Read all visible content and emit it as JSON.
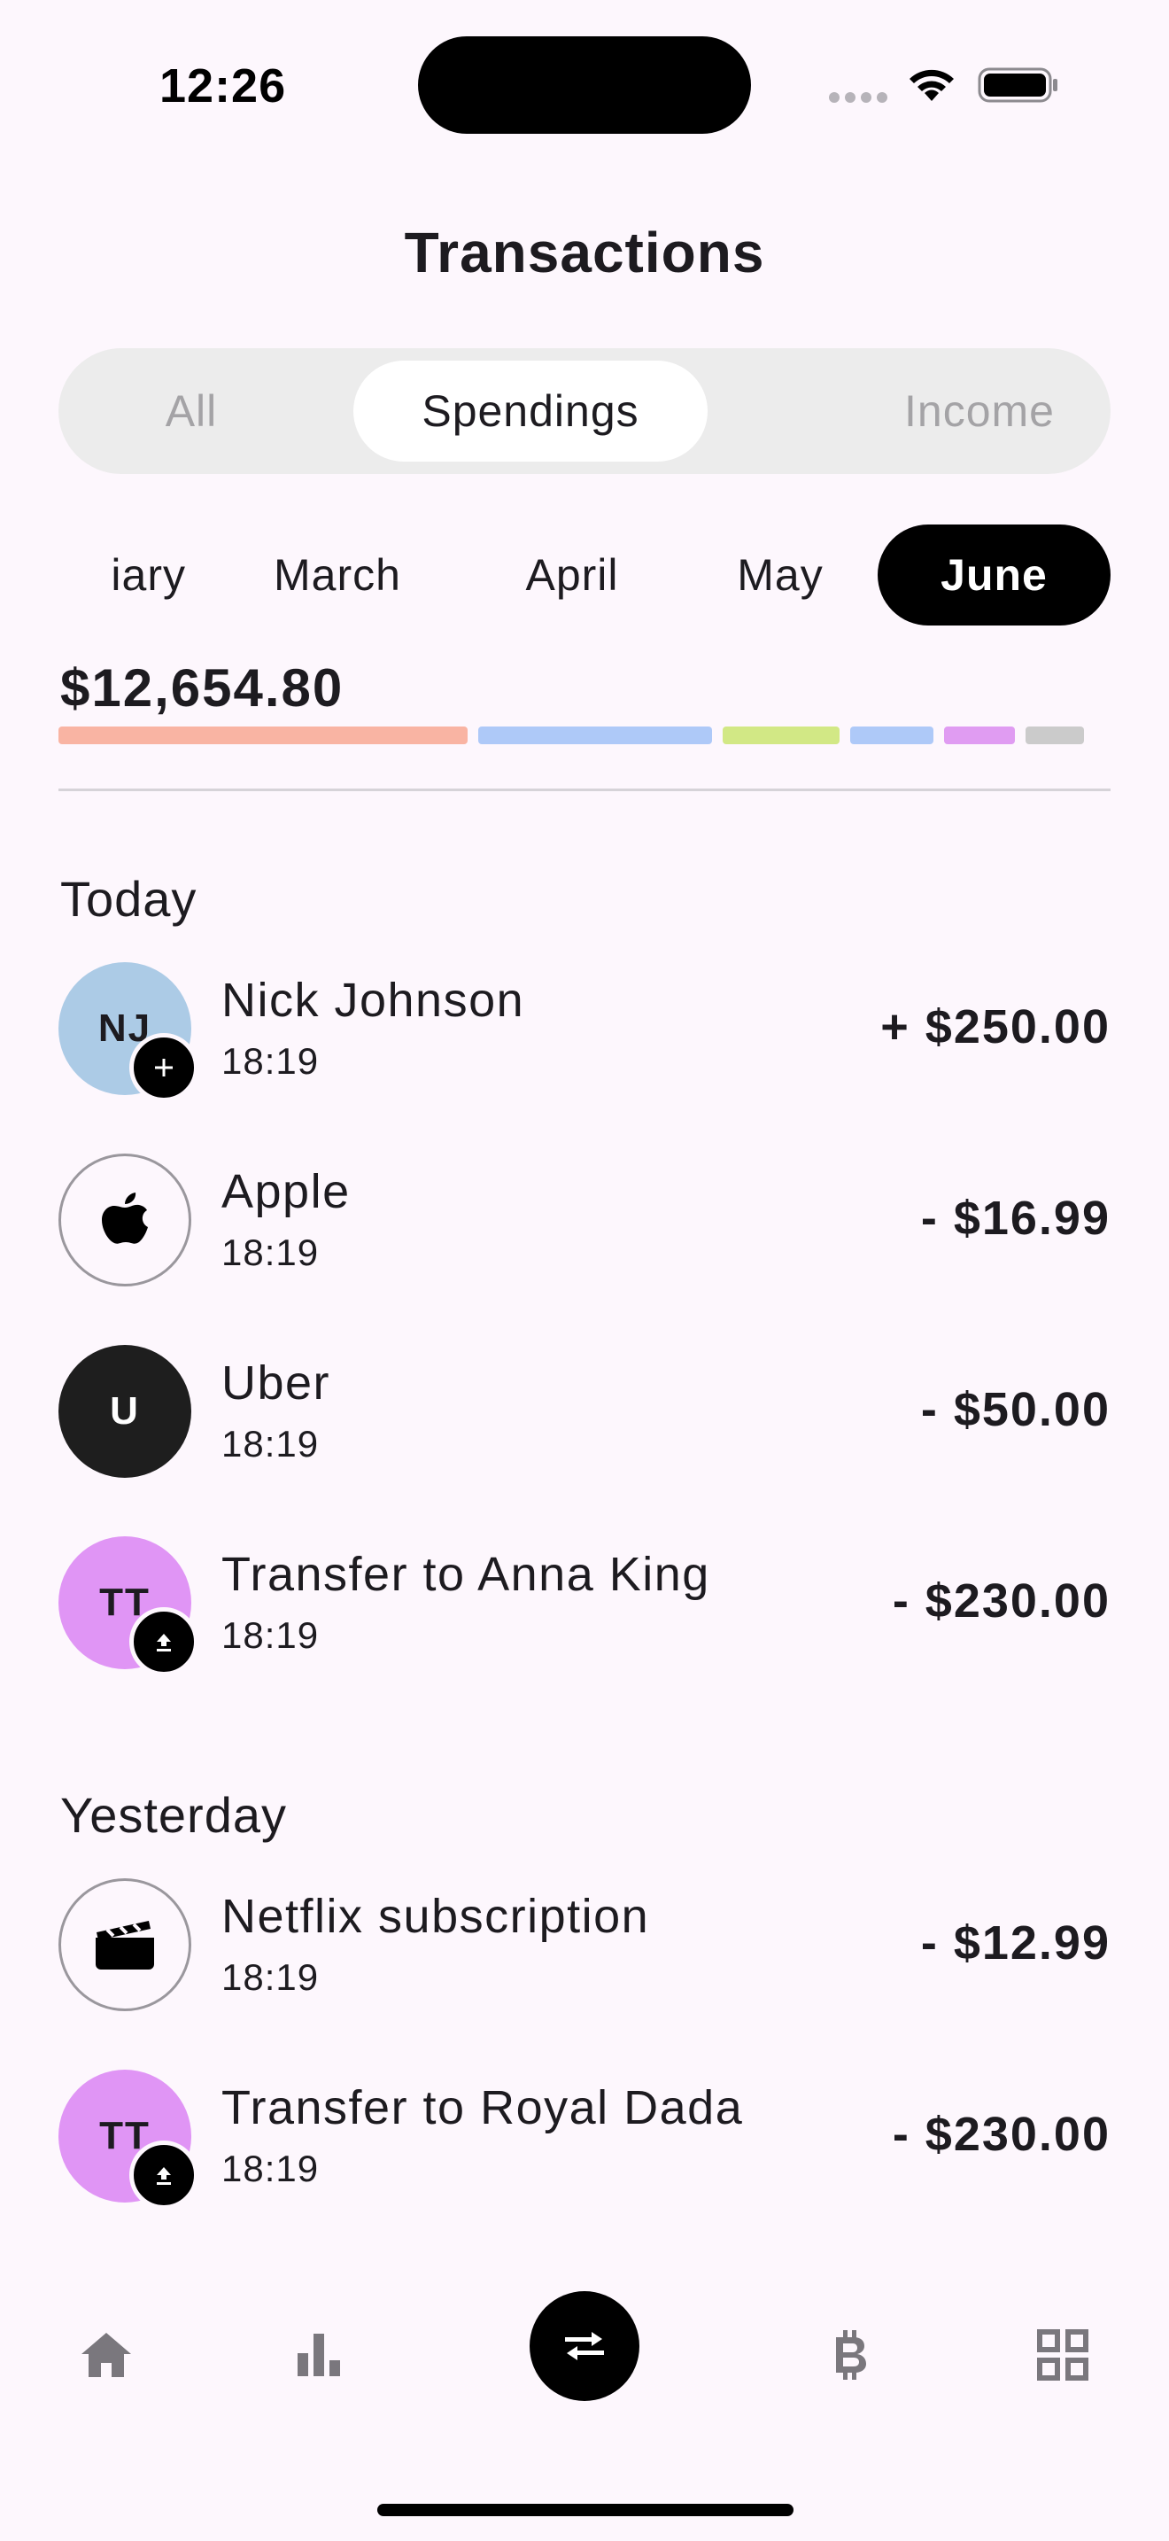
{
  "status_bar": {
    "time": "12:26"
  },
  "header": {
    "title": "Transactions"
  },
  "segments": {
    "all": "All",
    "spendings": "Spendings",
    "income": "Income",
    "selected": "Spendings"
  },
  "months": {
    "items": [
      "January",
      "March",
      "April",
      "May",
      "June"
    ],
    "partial_visible_text": "iary",
    "selected": "June"
  },
  "summary": {
    "total": "$12,654.80",
    "breakdown_colors": [
      "#f9b4a3",
      "#aec9f8",
      "#d2e885",
      "#aec9f8",
      "#e09cf2",
      "#cbcbcb"
    ]
  },
  "sections": [
    {
      "title": "Today",
      "transactions": [
        {
          "avatar_text": "NJ",
          "avatar_color": "#accbe6",
          "badge_icon": "plus-icon",
          "name": "Nick Johnson",
          "time": "18:19",
          "amount": "+ $250.00"
        },
        {
          "avatar_icon": "apple-logo-icon",
          "name": "Apple",
          "time": "18:19",
          "amount": "- $16.99"
        },
        {
          "avatar_text": "U",
          "avatar_color": "#1e1e1e",
          "name": "Uber",
          "time": "18:19",
          "amount": "- $50.00"
        },
        {
          "avatar_text": "TT",
          "avatar_color": "#e095f5",
          "badge_icon": "upload-icon",
          "name": "Transfer to Anna King",
          "time": "18:19",
          "amount": "- $230.00"
        }
      ]
    },
    {
      "title": "Yesterday",
      "transactions": [
        {
          "avatar_icon": "clapperboard-icon",
          "name": "Netflix subscription",
          "time": "18:19",
          "amount": "- $12.99"
        },
        {
          "avatar_text": "TT",
          "avatar_color": "#e095f5",
          "badge_icon": "upload-icon",
          "name": "Transfer to Royal Dada",
          "time": "18:19",
          "amount": "- $230.00"
        }
      ]
    }
  ],
  "bottom_nav": {
    "items": [
      "home-icon",
      "stats-icon",
      "transfer-icon",
      "bitcoin-icon",
      "grid-icon"
    ],
    "active": "transfer-icon"
  }
}
